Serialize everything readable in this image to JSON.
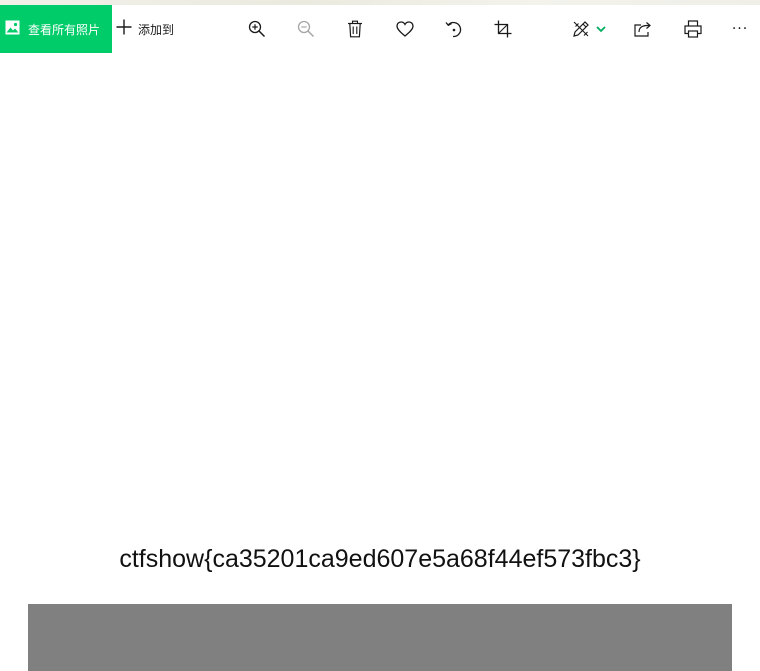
{
  "toolbar": {
    "view_all_label": "查看所有照片",
    "add_to_label": "添加到",
    "accent_color": "#00cc6a",
    "icons": [
      "picture-icon",
      "plus-icon",
      "zoom-in-icon",
      "zoom-out-icon",
      "trash-icon",
      "heart-icon",
      "rotate-icon",
      "crop-icon",
      "edit-icon",
      "chevron-down-icon",
      "share-icon",
      "print-icon",
      "more-icon"
    ],
    "more_label": "···"
  },
  "content": {
    "flag_text": "ctfshow{ca35201ca9ed607e5a68f44ef573fbc3}",
    "block_color": "#808080"
  }
}
